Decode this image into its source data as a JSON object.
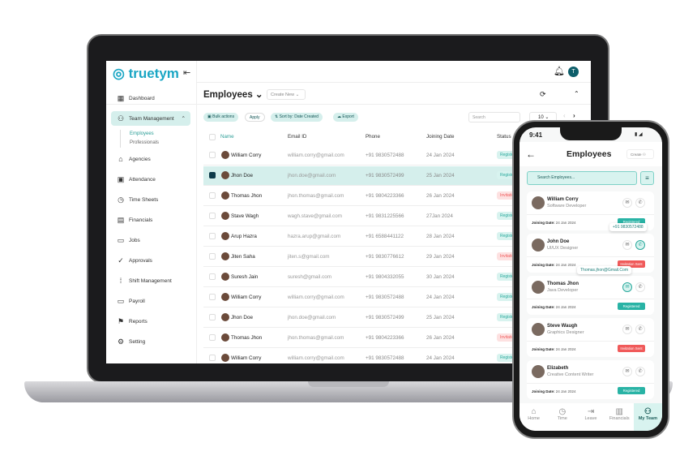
{
  "app": {
    "logo": "truetym",
    "collapse_icon": "collapse-left-icon"
  },
  "sidebar": {
    "items": [
      {
        "label": "Dashboard",
        "icon": "▦"
      },
      {
        "label": "Team Management",
        "icon": "⚇",
        "active": true
      },
      {
        "label": "Agencies",
        "icon": "⌂"
      },
      {
        "label": "Attendance",
        "icon": "▣"
      },
      {
        "label": "Time Sheets",
        "icon": "◷"
      },
      {
        "label": "Financials",
        "icon": "▤"
      },
      {
        "label": "Jobs",
        "icon": "▭"
      },
      {
        "label": "Approvals",
        "icon": "✓"
      },
      {
        "label": "Shift Management",
        "icon": "⁞"
      },
      {
        "label": "Payroll",
        "icon": "▭"
      },
      {
        "label": "Reports",
        "icon": "⚑"
      },
      {
        "label": "Setting",
        "icon": "⚙"
      }
    ],
    "sub_items": [
      "Employees",
      "Professionals"
    ]
  },
  "header": {
    "avatar_initial": "T"
  },
  "page": {
    "title": "Employees",
    "create_new": "Create New",
    "bulk_actions": "Bulk actions",
    "apply": "Apply",
    "sort": "Sort by: Date Created",
    "export": "Export",
    "search_placeholder": "Search",
    "page_size": "10"
  },
  "table": {
    "headers": [
      "Name",
      "Email ID",
      "Phone",
      "Joining Date",
      "Status"
    ],
    "rows": [
      {
        "name": "William Corry",
        "email": "william.corry@gmail.com",
        "phone": "+91 9830572488",
        "date": "24 Jan 2024",
        "status": "Registered"
      },
      {
        "name": "Jhon Doe",
        "email": "jhon.doe@gmail.com",
        "phone": "+91 9830572499",
        "date": "25 Jan 2024",
        "status": "Registered",
        "selected": true
      },
      {
        "name": "Thomas Jhon",
        "email": "jhon.thomas@gmail.com",
        "phone": "+91 9804223366",
        "date": "26 Jan 2024",
        "status": "Invitation Sent"
      },
      {
        "name": "Stave  Wagh",
        "email": "wagh.stave@gmail.com",
        "phone": "+91 9831225566",
        "date": "27Jan 2024",
        "status": "Registered"
      },
      {
        "name": "Arup Hazra",
        "email": "hazra.arup@gmail.com",
        "phone": "+91 6588441122",
        "date": "28 Jan 2024",
        "status": "Registered"
      },
      {
        "name": "Jiten Saha",
        "email": "jiten.s@gmail.com",
        "phone": "+91 9830776612",
        "date": "29 Jan 2024",
        "status": "Invitation Sent"
      },
      {
        "name": "Suresh Jain",
        "email": "suresh@gmail.com",
        "phone": "+91 9804332055",
        "date": "30 Jan 2024",
        "status": "Registered"
      },
      {
        "name": "William Corry",
        "email": "william.corry@gmail.com",
        "phone": "+91 9830572488",
        "date": "24 Jan 2024",
        "status": "Registered"
      },
      {
        "name": "Jhon Doe",
        "email": "jhon.doe@gmail.com",
        "phone": "+91 9830572499",
        "date": "25 Jan 2024",
        "status": "Registered"
      },
      {
        "name": "Thomas Jhon",
        "email": "jhon.thomas@gmail.com",
        "phone": "+91 9804223366",
        "date": "26 Jan 2024",
        "status": "Invitation Sent"
      },
      {
        "name": "William Corry",
        "email": "william.corry@gmail.com",
        "phone": "+91 9830572488",
        "date": "24 Jan 2024",
        "status": "Registered"
      }
    ]
  },
  "phone": {
    "time": "9:41",
    "title": "Employees",
    "create": "Create",
    "search_placeholder": "Search Employees...",
    "joining_label": "Joining Date:",
    "cards": [
      {
        "name": "William Corry",
        "role": "Software Developer",
        "date": "24 Jan 2024",
        "status": "Registered"
      },
      {
        "name": "John Doe",
        "role": "UI/UX Designer",
        "date": "24 Jan 2024",
        "status": "Invitation Sent",
        "tooltip": "+91 9830572488"
      },
      {
        "name": "Thomas Jhon",
        "role": "Java Developer",
        "date": "24 Jan 2024",
        "status": "Registered",
        "tooltip": "Thomas.jhon@Gmail.Com"
      },
      {
        "name": "Steve Waugh",
        "role": "Graphics Designer",
        "date": "24 Jan 2024",
        "status": "Invitation Sent"
      },
      {
        "name": "Elizabeth",
        "role": "Creative Content Writer",
        "date": "24 Jan 2024",
        "status": "Registered"
      }
    ],
    "nav": [
      {
        "label": "Home",
        "icon": "⌂"
      },
      {
        "label": "Time",
        "icon": "◷"
      },
      {
        "label": "Leave",
        "icon": "⇥"
      },
      {
        "label": "Financials",
        "icon": "▥"
      },
      {
        "label": "My Team",
        "icon": "⚇",
        "active": true
      }
    ]
  },
  "colors": {
    "accent": "#29a99c",
    "accent_light": "#d5efec",
    "invite": "#f05a5a",
    "brand": "#1aa6c4"
  }
}
